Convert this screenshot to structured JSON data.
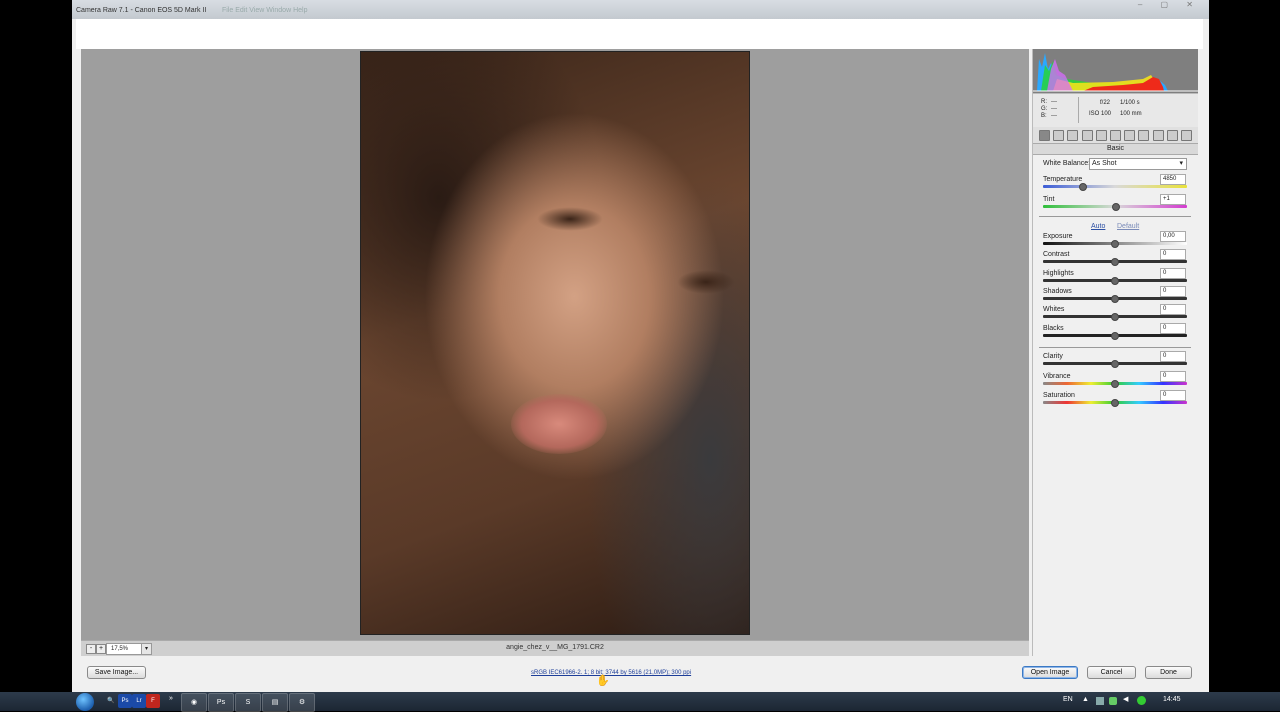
{
  "window": {
    "title": "Camera Raw 7.1 -  Canon EOS 5D Mark II",
    "background_menu_faint": "File   Edit   View   Window   Help",
    "controls": "–  ▢  ✕"
  },
  "preview": {
    "zoom_value": "17,5%",
    "zoom_minus": "-",
    "zoom_plus": "+",
    "zoom_dropdown": "▾",
    "filename": "angie_chez_v__MG_1791.CR2"
  },
  "info": {
    "r_label": "R:",
    "r_value": "---",
    "g_label": "G:",
    "g_value": "---",
    "b_label": "B:",
    "b_value": "---",
    "aperture": "f/22",
    "shutter": "1/100 s",
    "iso": "ISO 100",
    "focal": "100 mm"
  },
  "tools": [
    "basic-icon",
    "tone-curve-icon",
    "detail-icon",
    "hsl-icon",
    "split-tone-icon",
    "lens-icon",
    "effects-icon",
    "fx-icon",
    "camera-calibration-icon",
    "presets-icon",
    "snapshots-icon"
  ],
  "panel": {
    "tab_title": "Basic",
    "white_balance_label": "White Balance:",
    "white_balance_value": "As Shot",
    "auto_label": "Auto",
    "default_label": "Default",
    "sliders_wb": [
      {
        "label": "Temperature",
        "value": "4850",
        "level": 0.28
      },
      {
        "label": "Tint",
        "value": "+1",
        "level": 0.51
      }
    ],
    "sliders_tone": [
      {
        "label": "Exposure",
        "value": "0,00",
        "level": 0.5
      },
      {
        "label": "Contrast",
        "value": "0",
        "level": 0.5
      },
      {
        "label": "Highlights",
        "value": "0",
        "level": 0.5
      },
      {
        "label": "Shadows",
        "value": "0",
        "level": 0.5
      },
      {
        "label": "Whites",
        "value": "0",
        "level": 0.5
      },
      {
        "label": "Blacks",
        "value": "0",
        "level": 0.5
      }
    ],
    "sliders_presence": [
      {
        "label": "Clarity",
        "value": "0",
        "level": 0.5
      },
      {
        "label": "Vibrance",
        "value": "0",
        "level": 0.5
      },
      {
        "label": "Saturation",
        "value": "0",
        "level": 0.5
      }
    ]
  },
  "bottom": {
    "save_label": "Save Image...",
    "workflow_text": "sRGB IEC61966-2. 1; 8 bit; 3744 by 5616 (21,0MP); 300 ppi",
    "open_label": "Open Image",
    "cancel_label": "Cancel",
    "done_label": "Done"
  },
  "taskbar": {
    "language": "EN",
    "time": "14:45",
    "quicklaunch": [
      "search-icon",
      "ps-icon",
      "lr-icon",
      "flash-icon"
    ],
    "quicklaunch_labels": [
      "🔍",
      "Ps",
      "Lr",
      "F"
    ],
    "apps_labels": [
      "◉",
      "Ps",
      "S",
      "▤",
      "⚙"
    ],
    "more_label": "»"
  },
  "colors": {
    "accent_link": "#2b4fa3",
    "taskbar": "#1c2633",
    "preview_bg": "#9e9e9e"
  }
}
